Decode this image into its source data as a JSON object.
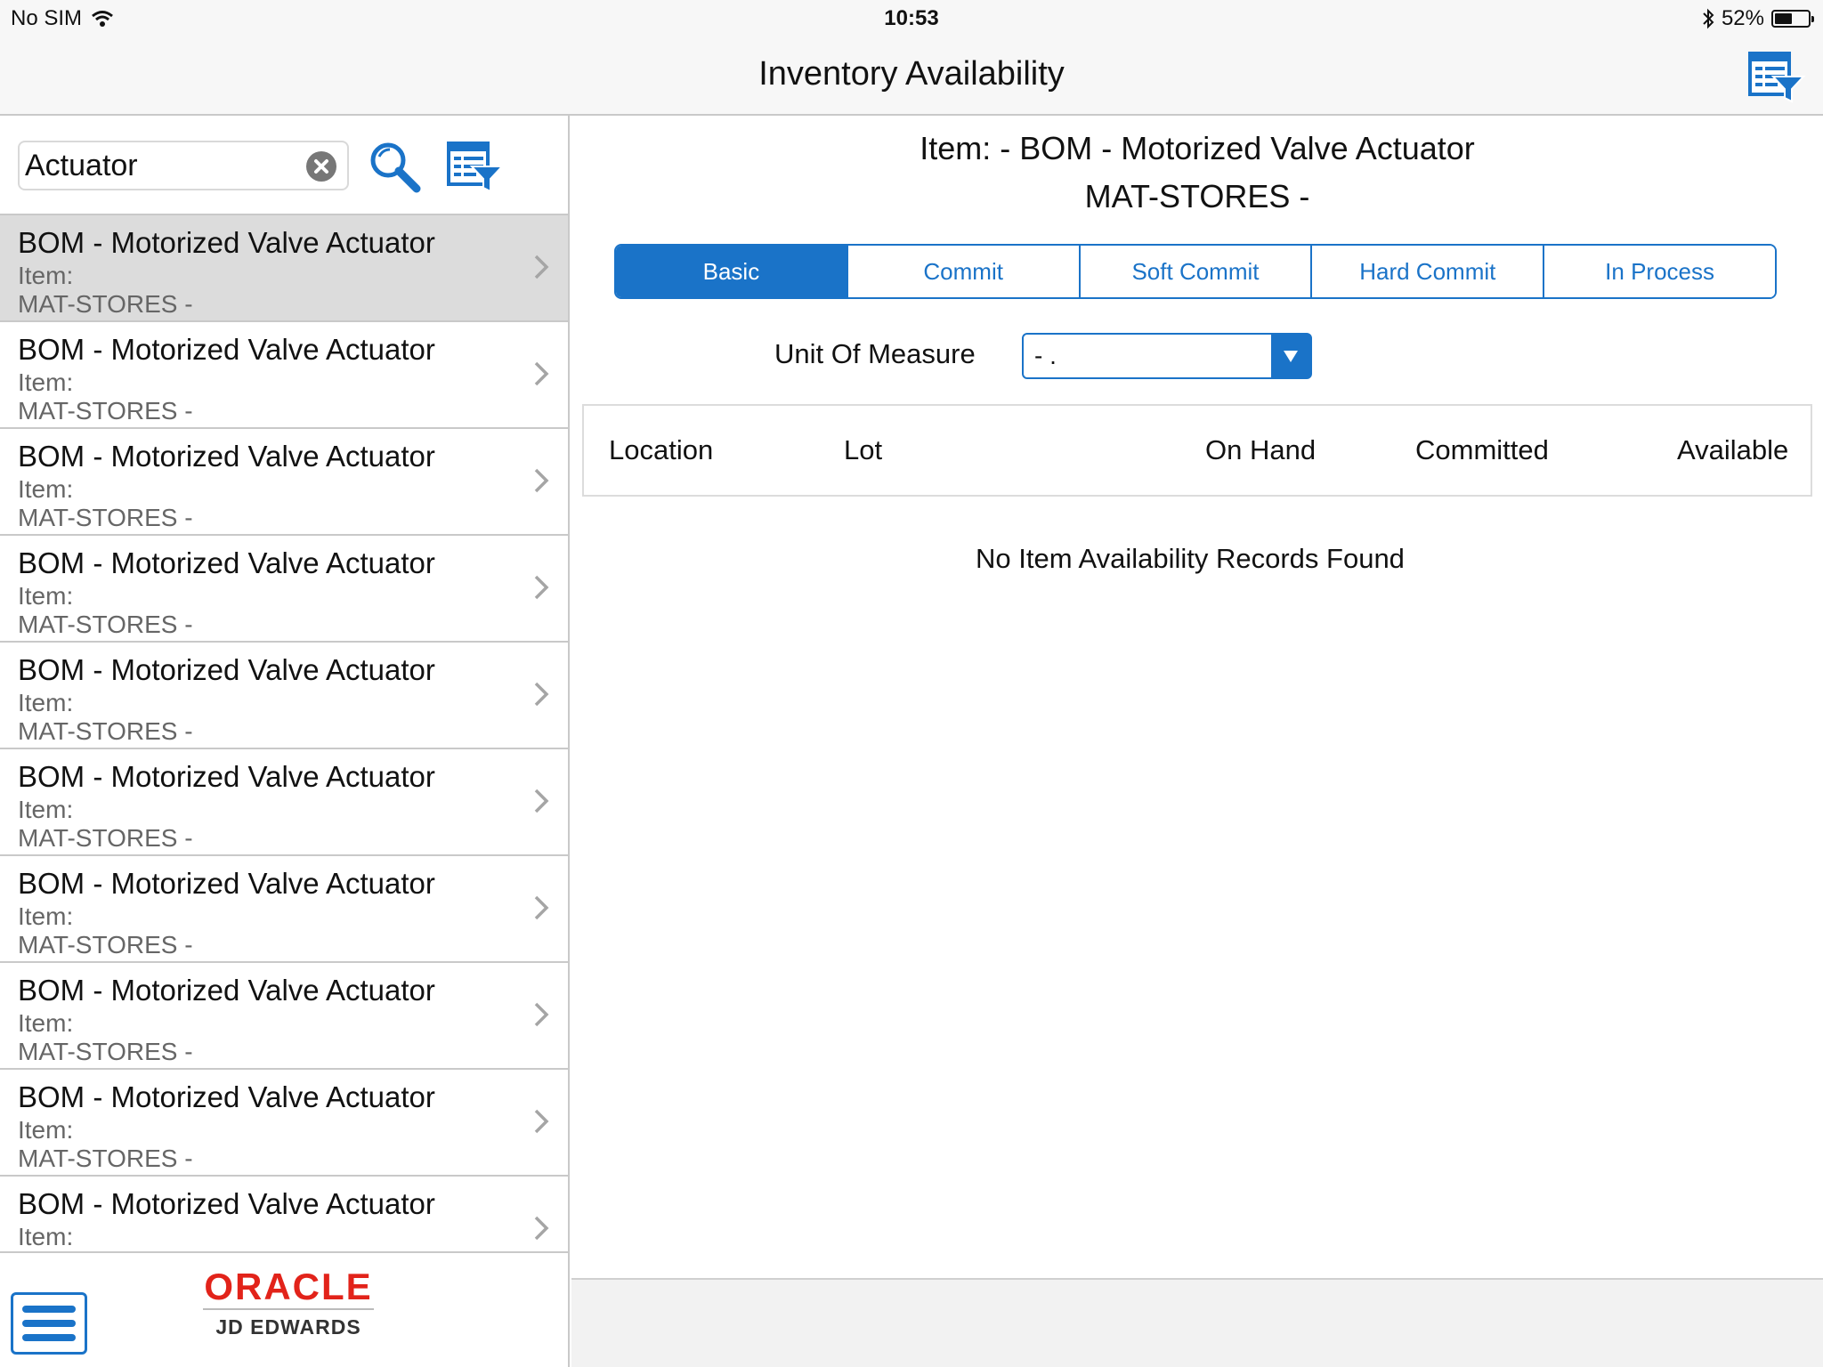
{
  "status_bar": {
    "carrier": "No SIM",
    "time": "10:53",
    "battery": "52%",
    "battery_level": 0.52
  },
  "nav": {
    "title": "Inventory Availability",
    "filter_icon": "filter-list-icon"
  },
  "search": {
    "value": "Actuator",
    "clear_icon": "clear-icon",
    "search_icon": "magnifier-icon",
    "filter_icon": "filter-list-icon"
  },
  "list": {
    "items": [
      {
        "name": "BOM - Motorized Valve Actuator",
        "item_label": "Item:",
        "branch": "MAT-STORES -",
        "selected": true
      },
      {
        "name": "BOM - Motorized Valve Actuator",
        "item_label": "Item:",
        "branch": "MAT-STORES -"
      },
      {
        "name": "BOM - Motorized Valve Actuator",
        "item_label": "Item:",
        "branch": "MAT-STORES -"
      },
      {
        "name": "BOM - Motorized Valve Actuator",
        "item_label": "Item:",
        "branch": "MAT-STORES -"
      },
      {
        "name": "BOM - Motorized Valve Actuator",
        "item_label": "Item:",
        "branch": "MAT-STORES -"
      },
      {
        "name": "BOM - Motorized Valve Actuator",
        "item_label": "Item:",
        "branch": "MAT-STORES -"
      },
      {
        "name": "BOM - Motorized Valve Actuator",
        "item_label": "Item:",
        "branch": "MAT-STORES -"
      },
      {
        "name": "BOM - Motorized Valve Actuator",
        "item_label": "Item:",
        "branch": "MAT-STORES -"
      },
      {
        "name": "BOM - Motorized Valve Actuator",
        "item_label": "Item:",
        "branch": "MAT-STORES -"
      },
      {
        "name": "BOM - Motorized Valve Actuator",
        "item_label": "Item:",
        "branch": ""
      }
    ]
  },
  "footer": {
    "logo_top": "ORACLE",
    "logo_bottom": "JD EDWARDS",
    "menu_icon": "hamburger-menu-icon"
  },
  "detail": {
    "title_line1": "Item: - BOM - Motorized Valve Actuator",
    "title_line2": "MAT-STORES -",
    "tabs": [
      {
        "label": "Basic",
        "active": true
      },
      {
        "label": "Commit"
      },
      {
        "label": "Soft Commit"
      },
      {
        "label": "Hard Commit"
      },
      {
        "label": "In Process"
      }
    ],
    "uom_label": "Unit Of Measure",
    "uom_value": "- .",
    "columns": [
      "Location",
      "Lot",
      "On Hand",
      "Committed",
      "Available"
    ],
    "empty_message": "No Item Availability Records Found"
  },
  "colors": {
    "accent": "#1a73c8",
    "oracle_red": "#e2231a",
    "selected_row": "#dcdcdc"
  }
}
